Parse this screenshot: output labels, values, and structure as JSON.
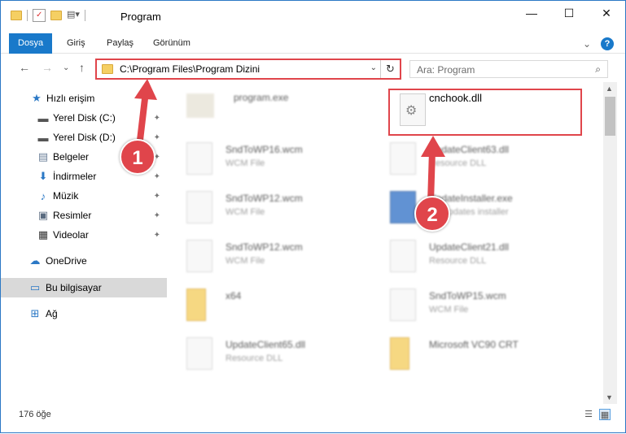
{
  "window": {
    "title": "Program",
    "buttons": [
      "—",
      "☐",
      "✕"
    ]
  },
  "ribbon": {
    "tabs": [
      "Dosya",
      "Giriş",
      "Paylaş",
      "Görünüm"
    ],
    "collapse": "⌄",
    "help": "?"
  },
  "nav": {
    "back": "←",
    "forward": "→",
    "recent": "⌄",
    "up": "↑",
    "address": "C:\\Program Files\\Program Dizini",
    "address_dropdown": "⌄",
    "refresh": "↻",
    "search_placeholder": "Ara: Program",
    "search_icon": "⌕"
  },
  "sidebar": {
    "items": [
      {
        "label": "Hızlı erişim",
        "icon": "star-icon",
        "glyph": "★",
        "pinned": false
      },
      {
        "label": "Yerel Disk (C:)",
        "icon": "drive-icon",
        "glyph": "▬",
        "pinned": true
      },
      {
        "label": "Yerel Disk (D:)",
        "icon": "drive-icon",
        "glyph": "▬",
        "pinned": true
      },
      {
        "label": "Belgeler",
        "icon": "documents-icon",
        "glyph": "▤",
        "pinned": true
      },
      {
        "label": "İndirmeler",
        "icon": "downloads-icon",
        "glyph": "⬇",
        "pinned": true
      },
      {
        "label": "Müzik",
        "icon": "music-icon",
        "glyph": "♪",
        "pinned": true
      },
      {
        "label": "Resimler",
        "icon": "pictures-icon",
        "glyph": "▣",
        "pinned": true
      },
      {
        "label": "Videolar",
        "icon": "videos-icon",
        "glyph": "▦",
        "pinned": true
      },
      {
        "label": "OneDrive",
        "icon": "cloud-icon",
        "glyph": "☁",
        "pinned": false
      },
      {
        "label": "Bu bilgisayar",
        "icon": "computer-icon",
        "glyph": "▭",
        "pinned": false
      },
      {
        "label": "Ağ",
        "icon": "network-icon",
        "glyph": "⊞",
        "pinned": false
      }
    ],
    "pin_glyph": "📌"
  },
  "files": [
    {
      "name": "program.exe",
      "type": ""
    },
    {
      "name": "cnchook.dll",
      "type": ""
    },
    {
      "name": "SndToWP16.wcm",
      "type": "WCM File"
    },
    {
      "name": "UpdateClient63.dll",
      "type": "Resource DLL"
    },
    {
      "name": "SndToWP12.wcm",
      "type": "WCM File"
    },
    {
      "name": "UpdateInstaller.exe",
      "type": "BY updates installer"
    },
    {
      "name": "SndToWP12.wcm",
      "type": "WCM File"
    },
    {
      "name": "UpdateClient21.dll",
      "type": "Resource DLL"
    },
    {
      "name": "x64",
      "type": ""
    },
    {
      "name": "SndToWP15.wcm",
      "type": "WCM File"
    },
    {
      "name": "UpdateClient65.dll",
      "type": "Resource DLL"
    },
    {
      "name": "Microsoft VC90 CRT",
      "type": ""
    }
  ],
  "annotations": {
    "badge1": "1",
    "badge2": "2"
  },
  "status": {
    "item_count": "176 öğe"
  },
  "colors": {
    "accent": "#1979ca",
    "highlight": "#e0454b"
  }
}
